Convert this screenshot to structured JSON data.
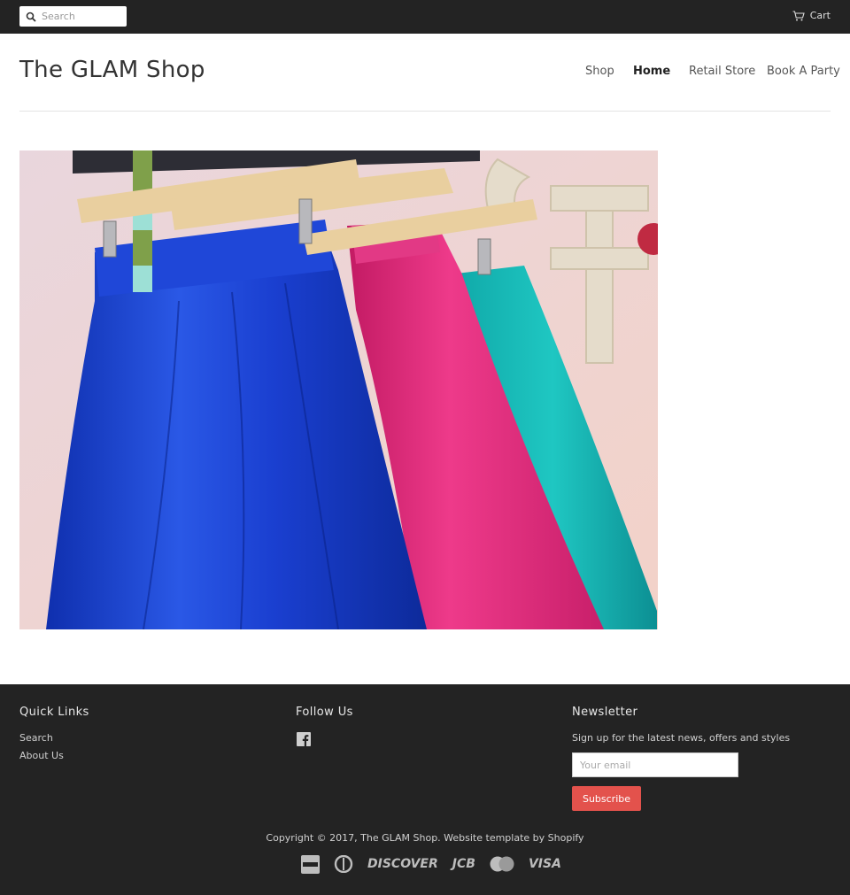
{
  "topbar": {
    "search_placeholder": "Search",
    "cart_label": "Cart"
  },
  "header": {
    "site_title": "The GLAM Shop",
    "nav": [
      {
        "label": "Shop",
        "active": false
      },
      {
        "label": "Home",
        "active": true
      },
      {
        "label": "Retail Store",
        "active": false
      },
      {
        "label": "Book A Party",
        "active": false
      }
    ]
  },
  "hero": {
    "icon": "photo-of-skirts-on-hangers"
  },
  "footer": {
    "quick_links": {
      "title": "Quick Links",
      "items": [
        "Search",
        "About Us"
      ]
    },
    "follow_us": {
      "title": "Follow Us",
      "icon": "facebook-icon"
    },
    "newsletter": {
      "title": "Newsletter",
      "text": "Sign up for the latest news, offers and styles",
      "email_placeholder": "Your email",
      "button_label": "Subscribe"
    },
    "copyright": "Copyright © 2017, The GLAM Shop. Website template by Shopify",
    "payments": [
      "amex-icon",
      "diners-club-icon",
      "discover-icon",
      "jcb-icon",
      "mastercard-icon",
      "visa-icon"
    ],
    "payment_labels": {
      "discover": "DISCOVER",
      "jcb": "JCB",
      "visa": "VISA"
    }
  },
  "colors": {
    "topbar_bg": "#232323",
    "footer_bg": "#232323",
    "subscribe_bg": "#e3524c"
  }
}
